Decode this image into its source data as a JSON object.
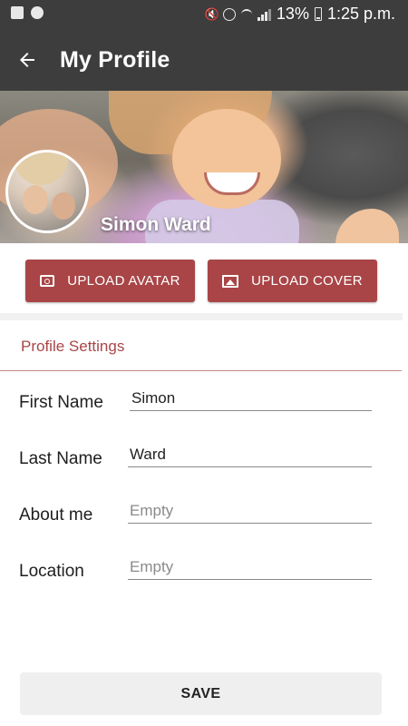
{
  "status_bar": {
    "battery_percent": "13%",
    "time": "1:25 p.m."
  },
  "app_bar": {
    "title": "My Profile"
  },
  "profile": {
    "name": "Simon Ward"
  },
  "buttons": {
    "upload_avatar": "UPLOAD AVATAR",
    "upload_cover": "UPLOAD COVER",
    "save": "SAVE"
  },
  "settings": {
    "section_title": "Profile Settings",
    "fields": [
      {
        "label": "First Name",
        "value": "Simon",
        "placeholder": ""
      },
      {
        "label": "Last Name",
        "value": "Ward",
        "placeholder": ""
      },
      {
        "label": "About me",
        "value": "",
        "placeholder": "Empty"
      },
      {
        "label": "Location",
        "value": "",
        "placeholder": "Empty"
      }
    ]
  },
  "colors": {
    "toolbar": "#3d3d3d",
    "accent": "#a94547"
  }
}
